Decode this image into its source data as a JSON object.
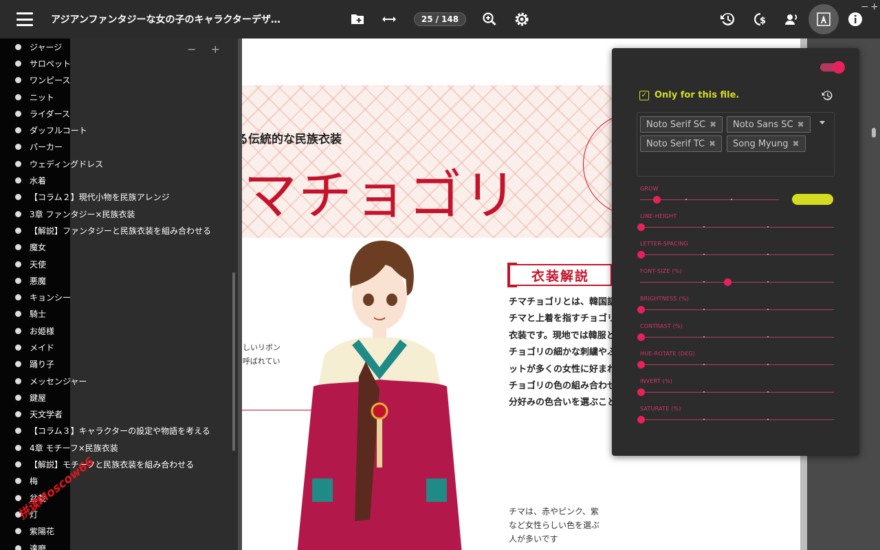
{
  "topbar": {
    "title": "アジアンファンタジーな女の子のキャラクターデザインブ...",
    "page_current": "25",
    "page_sep": "/",
    "page_total": "148",
    "window_min": "−",
    "window_max": "+"
  },
  "toc": {
    "controls": "− +",
    "items": [
      "ジャージ",
      "サロペット",
      "ワンピース",
      "ニット",
      "ライダース",
      "ダッフルコート",
      "パーカー",
      "ウェディングドレス",
      "水着",
      "【コラム２】現代小物を民族アレンジ",
      "3章 ファンタジー×民族衣装",
      "【解説】ファンタジーと民族衣装を組み合わせる",
      "魔女",
      "天使",
      "悪魔",
      "キョンシー",
      "騎士",
      "お姫様",
      "メイド",
      "踊り子",
      "メッセンジャー",
      "鍵屋",
      "天文学者",
      "【コラム３】キャラクターの設定や物語を考える",
      "4章 モチーフ×民族衣装",
      "【解説】モチーフと民族衣装を組み合わせる",
      "梅",
      "盆栽",
      "灯",
      "紫陽花",
      "達磨"
    ],
    "watermark": "拼读Moscow66"
  },
  "page": {
    "subtitle": "韓国が誇る伝統的な民族衣装",
    "title": "チマチョゴリ",
    "section_label": "衣装解説",
    "body": "チマチョゴリとは、韓国語でスカートを指すチマと上着を指すチョゴリで構成される伝統衣装です。現地では韓服と呼ばれています。チョゴリの細かな刺繍やふんわり長いシルエットが多くの女性に好まれています。チマとチョゴリの色の組み合わせは自由なので、自分好みの色合いを選ぶことができます。",
    "note_left": "胸元のかわいらしいリボンはオッコルンと呼ばれています",
    "note_bottom": "チマは、赤やピンク、紫など女性らしい色を選ぶ人が多いです"
  },
  "panel": {
    "only_label": "Only for this file.",
    "only_checked": true,
    "enabled": true,
    "fonts": [
      "Noto Serif SC",
      "Noto Sans SC",
      "Noto Serif TC",
      "Song Myung"
    ],
    "chip_remove": "✖",
    "sliders": [
      {
        "label": "GROW",
        "value": 0.12
      },
      {
        "label": "LINE-HEIGHT",
        "value": 0.0
      },
      {
        "label": "LETTER-SPACING",
        "value": 0.0
      },
      {
        "label": "FONT-SIZE (%)",
        "value": 0.45
      },
      {
        "label": "BRIGHTNESS (%)",
        "value": 0.0
      },
      {
        "label": "CONTRAST (%)",
        "value": 0.0
      },
      {
        "label": "HUE-ROTATE (DEG)",
        "value": 0.0
      },
      {
        "label": "INVERT (%)",
        "value": 0.0
      },
      {
        "label": "SATURATE (%)",
        "value": 0.0
      }
    ],
    "accent": "#e8215a",
    "highlight": "#d4dc22"
  },
  "icons": [
    "menu-icon",
    "add-folder-icon",
    "fit-width-icon",
    "zoom-icon",
    "settings-icon",
    "history-icon",
    "currency-icon",
    "voice-icon",
    "font-icon",
    "info-icon"
  ]
}
